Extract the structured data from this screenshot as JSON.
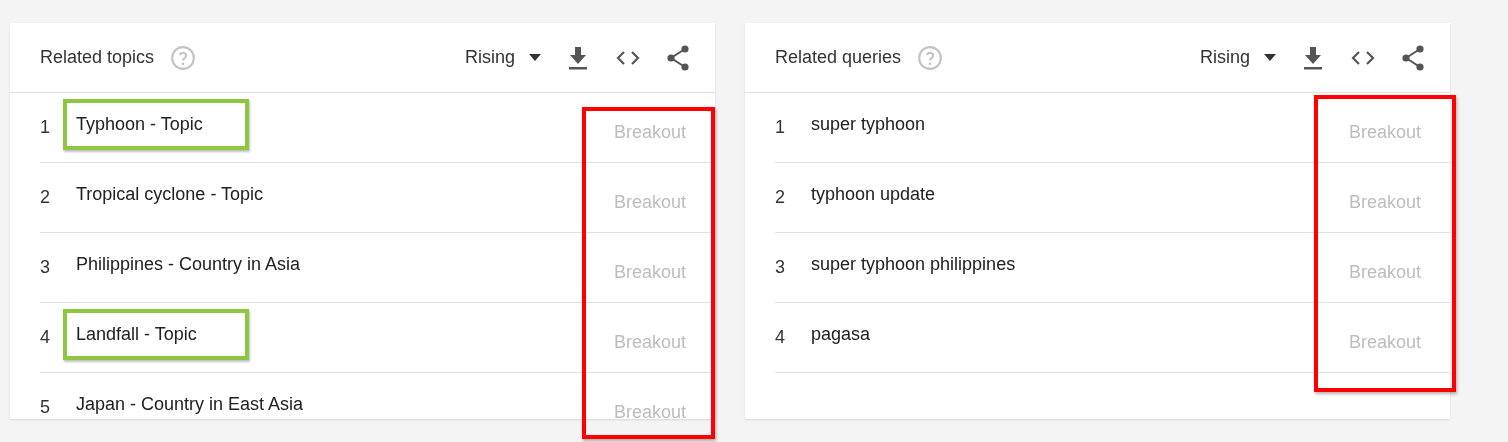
{
  "panels": [
    {
      "title": "Related topics",
      "filter": "Rising",
      "value_column_outlined": true,
      "items": [
        {
          "rank": "1",
          "label": "Typhoon - Topic",
          "value": "Breakout",
          "highlighted": true
        },
        {
          "rank": "2",
          "label": "Tropical cyclone - Topic",
          "value": "Breakout",
          "highlighted": false
        },
        {
          "rank": "3",
          "label": "Philippines - Country in Asia",
          "value": "Breakout",
          "highlighted": false
        },
        {
          "rank": "4",
          "label": "Landfall - Topic",
          "value": "Breakout",
          "highlighted": true
        },
        {
          "rank": "5",
          "label": "Japan - Country in East Asia",
          "value": "Breakout",
          "highlighted": false
        }
      ]
    },
    {
      "title": "Related queries",
      "filter": "Rising",
      "value_column_outlined": true,
      "items": [
        {
          "rank": "1",
          "label": "super typhoon",
          "value": "Breakout",
          "highlighted": false
        },
        {
          "rank": "2",
          "label": "typhoon update",
          "value": "Breakout",
          "highlighted": false
        },
        {
          "rank": "3",
          "label": "super typhoon philippines",
          "value": "Breakout",
          "highlighted": false
        },
        {
          "rank": "4",
          "label": "pagasa",
          "value": "Breakout",
          "highlighted": false
        }
      ]
    }
  ]
}
